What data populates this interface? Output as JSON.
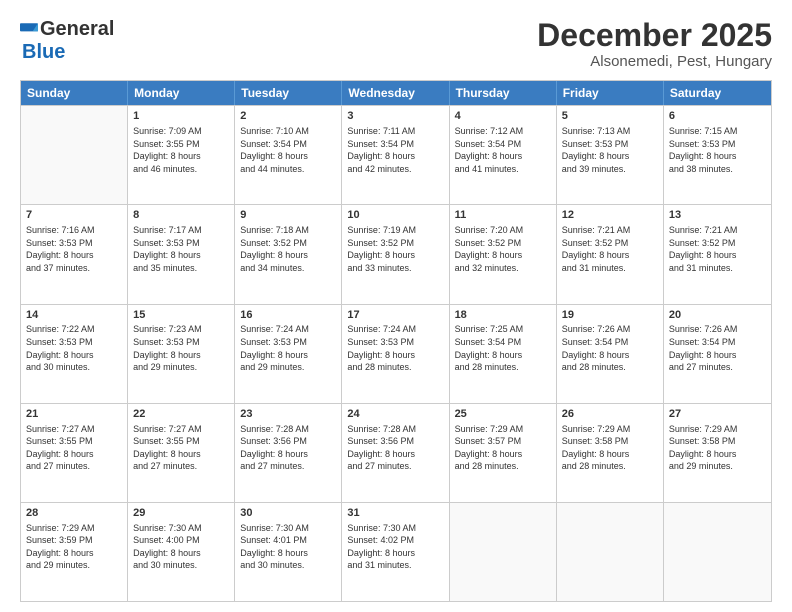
{
  "header": {
    "logo_line1": "General",
    "logo_line2": "Blue",
    "month": "December 2025",
    "location": "Alsonemedi, Pest, Hungary"
  },
  "days_of_week": [
    "Sunday",
    "Monday",
    "Tuesday",
    "Wednesday",
    "Thursday",
    "Friday",
    "Saturday"
  ],
  "weeks": [
    [
      {
        "day": "",
        "info": ""
      },
      {
        "day": "1",
        "info": "Sunrise: 7:09 AM\nSunset: 3:55 PM\nDaylight: 8 hours\nand 46 minutes."
      },
      {
        "day": "2",
        "info": "Sunrise: 7:10 AM\nSunset: 3:54 PM\nDaylight: 8 hours\nand 44 minutes."
      },
      {
        "day": "3",
        "info": "Sunrise: 7:11 AM\nSunset: 3:54 PM\nDaylight: 8 hours\nand 42 minutes."
      },
      {
        "day": "4",
        "info": "Sunrise: 7:12 AM\nSunset: 3:54 PM\nDaylight: 8 hours\nand 41 minutes."
      },
      {
        "day": "5",
        "info": "Sunrise: 7:13 AM\nSunset: 3:53 PM\nDaylight: 8 hours\nand 39 minutes."
      },
      {
        "day": "6",
        "info": "Sunrise: 7:15 AM\nSunset: 3:53 PM\nDaylight: 8 hours\nand 38 minutes."
      }
    ],
    [
      {
        "day": "7",
        "info": "Sunrise: 7:16 AM\nSunset: 3:53 PM\nDaylight: 8 hours\nand 37 minutes."
      },
      {
        "day": "8",
        "info": "Sunrise: 7:17 AM\nSunset: 3:53 PM\nDaylight: 8 hours\nand 35 minutes."
      },
      {
        "day": "9",
        "info": "Sunrise: 7:18 AM\nSunset: 3:52 PM\nDaylight: 8 hours\nand 34 minutes."
      },
      {
        "day": "10",
        "info": "Sunrise: 7:19 AM\nSunset: 3:52 PM\nDaylight: 8 hours\nand 33 minutes."
      },
      {
        "day": "11",
        "info": "Sunrise: 7:20 AM\nSunset: 3:52 PM\nDaylight: 8 hours\nand 32 minutes."
      },
      {
        "day": "12",
        "info": "Sunrise: 7:21 AM\nSunset: 3:52 PM\nDaylight: 8 hours\nand 31 minutes."
      },
      {
        "day": "13",
        "info": "Sunrise: 7:21 AM\nSunset: 3:52 PM\nDaylight: 8 hours\nand 31 minutes."
      }
    ],
    [
      {
        "day": "14",
        "info": "Sunrise: 7:22 AM\nSunset: 3:53 PM\nDaylight: 8 hours\nand 30 minutes."
      },
      {
        "day": "15",
        "info": "Sunrise: 7:23 AM\nSunset: 3:53 PM\nDaylight: 8 hours\nand 29 minutes."
      },
      {
        "day": "16",
        "info": "Sunrise: 7:24 AM\nSunset: 3:53 PM\nDaylight: 8 hours\nand 29 minutes."
      },
      {
        "day": "17",
        "info": "Sunrise: 7:24 AM\nSunset: 3:53 PM\nDaylight: 8 hours\nand 28 minutes."
      },
      {
        "day": "18",
        "info": "Sunrise: 7:25 AM\nSunset: 3:54 PM\nDaylight: 8 hours\nand 28 minutes."
      },
      {
        "day": "19",
        "info": "Sunrise: 7:26 AM\nSunset: 3:54 PM\nDaylight: 8 hours\nand 28 minutes."
      },
      {
        "day": "20",
        "info": "Sunrise: 7:26 AM\nSunset: 3:54 PM\nDaylight: 8 hours\nand 27 minutes."
      }
    ],
    [
      {
        "day": "21",
        "info": "Sunrise: 7:27 AM\nSunset: 3:55 PM\nDaylight: 8 hours\nand 27 minutes."
      },
      {
        "day": "22",
        "info": "Sunrise: 7:27 AM\nSunset: 3:55 PM\nDaylight: 8 hours\nand 27 minutes."
      },
      {
        "day": "23",
        "info": "Sunrise: 7:28 AM\nSunset: 3:56 PM\nDaylight: 8 hours\nand 27 minutes."
      },
      {
        "day": "24",
        "info": "Sunrise: 7:28 AM\nSunset: 3:56 PM\nDaylight: 8 hours\nand 27 minutes."
      },
      {
        "day": "25",
        "info": "Sunrise: 7:29 AM\nSunset: 3:57 PM\nDaylight: 8 hours\nand 28 minutes."
      },
      {
        "day": "26",
        "info": "Sunrise: 7:29 AM\nSunset: 3:58 PM\nDaylight: 8 hours\nand 28 minutes."
      },
      {
        "day": "27",
        "info": "Sunrise: 7:29 AM\nSunset: 3:58 PM\nDaylight: 8 hours\nand 29 minutes."
      }
    ],
    [
      {
        "day": "28",
        "info": "Sunrise: 7:29 AM\nSunset: 3:59 PM\nDaylight: 8 hours\nand 29 minutes."
      },
      {
        "day": "29",
        "info": "Sunrise: 7:30 AM\nSunset: 4:00 PM\nDaylight: 8 hours\nand 30 minutes."
      },
      {
        "day": "30",
        "info": "Sunrise: 7:30 AM\nSunset: 4:01 PM\nDaylight: 8 hours\nand 30 minutes."
      },
      {
        "day": "31",
        "info": "Sunrise: 7:30 AM\nSunset: 4:02 PM\nDaylight: 8 hours\nand 31 minutes."
      },
      {
        "day": "",
        "info": ""
      },
      {
        "day": "",
        "info": ""
      },
      {
        "day": "",
        "info": ""
      }
    ]
  ]
}
